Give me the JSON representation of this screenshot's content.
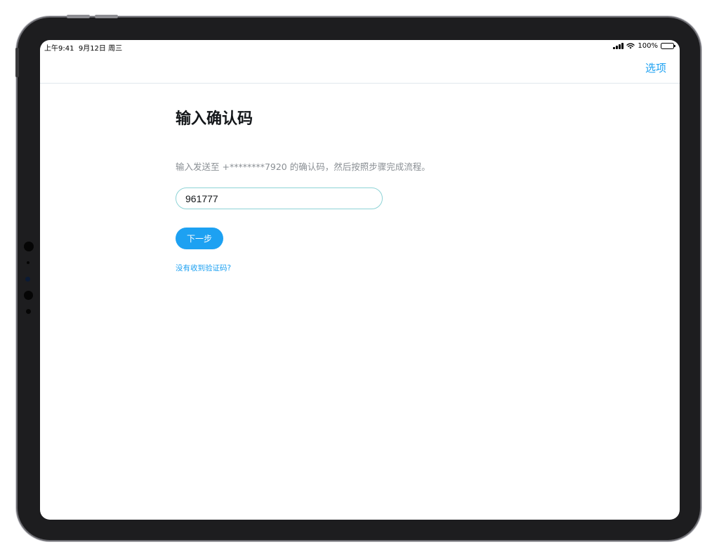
{
  "status_bar": {
    "time": "上午9:41",
    "date": "9月12日 周三",
    "battery": "100%",
    "icons": [
      "signal-bars-icon",
      "wifi-icon",
      "battery-icon"
    ]
  },
  "nav": {
    "options_label": "选项"
  },
  "main": {
    "title": "输入确认码",
    "description": "输入发送至 +********7920 的确认码，然后按照步骤完成流程。",
    "code_value": "961777",
    "next_label": "下一步",
    "help_link": "没有收到验证码?"
  },
  "colors": {
    "accent": "#1da1f2",
    "title": "#14171a",
    "secondary_text": "#8a8f94",
    "input_border": "#8ed3d6",
    "device_bezel": "#1d1d1f"
  }
}
